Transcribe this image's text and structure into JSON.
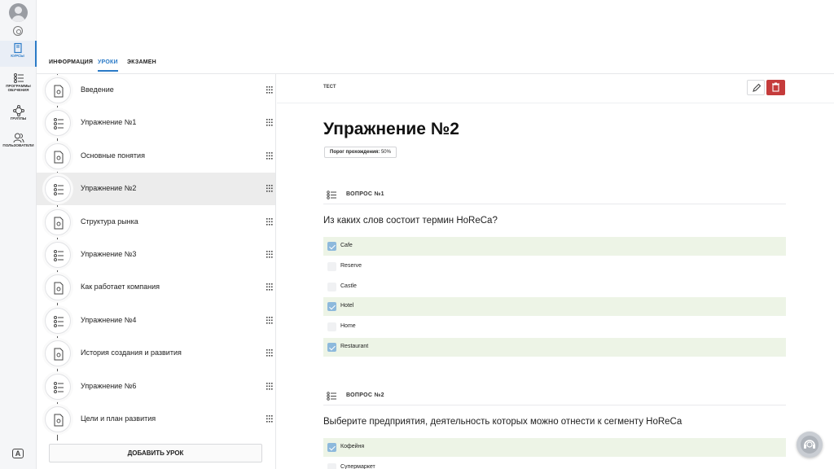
{
  "rail": {
    "items": [
      {
        "label": "КУРСЫ",
        "icon": "book-icon",
        "active": true
      },
      {
        "label": "ПРОГРАММЫ ОБУЧЕНИЯ",
        "icon": "list-icon",
        "active": false
      },
      {
        "label": "ГРУППЫ",
        "icon": "network-icon",
        "active": false
      },
      {
        "label": "ПОЛЬЗОВАТЕЛИ",
        "icon": "users-icon",
        "active": false
      }
    ]
  },
  "tabs": [
    {
      "label": "ИНФОРМАЦИЯ",
      "active": false
    },
    {
      "label": "УРОКИ",
      "active": true
    },
    {
      "label": "ЭКЗАМЕН",
      "active": false
    }
  ],
  "lessons": [
    {
      "title": "Введение",
      "type": "document"
    },
    {
      "title": "Упражнение №1",
      "type": "test"
    },
    {
      "title": "Основные понятия",
      "type": "document"
    },
    {
      "title": "Упражнение №2",
      "type": "test",
      "active": true
    },
    {
      "title": "Структура рынка",
      "type": "document"
    },
    {
      "title": "Упражнение №3",
      "type": "test"
    },
    {
      "title": "Как работает компания",
      "type": "document"
    },
    {
      "title": "Упражнение №4",
      "type": "test"
    },
    {
      "title": "История создания и развития",
      "type": "document"
    },
    {
      "title": "Упражнение №6",
      "type": "test"
    },
    {
      "title": "Цели и план развития",
      "type": "document"
    }
  ],
  "add_lesson_label": "ДОБАВИТЬ УРОК",
  "main": {
    "type_label": "ТЕСТ",
    "title": "Упражнение №2",
    "threshold_label": "Порог прохождения:",
    "threshold_value": "50%",
    "questions": [
      {
        "label": "ВОПРОС №1",
        "text": "Из каких слов состоит термин HoReCa?",
        "options": [
          {
            "text": "Cafe",
            "correct": true
          },
          {
            "text": "Reserve",
            "correct": false
          },
          {
            "text": "Castle",
            "correct": false
          },
          {
            "text": "Hotel",
            "correct": true
          },
          {
            "text": "Home",
            "correct": false
          },
          {
            "text": "Restaurant",
            "correct": true
          }
        ]
      },
      {
        "label": "ВОПРОС №2",
        "text": "Выберите предприятия, деятельность которых можно отнести к сегменту HoReCa",
        "options": [
          {
            "text": "Кофейня",
            "correct": true
          },
          {
            "text": "Супермаркет",
            "correct": false
          }
        ]
      }
    ]
  },
  "colors": {
    "accent": "#2a7ac7",
    "danger": "#c53b3b",
    "correct_bg": "#edf4e6"
  }
}
